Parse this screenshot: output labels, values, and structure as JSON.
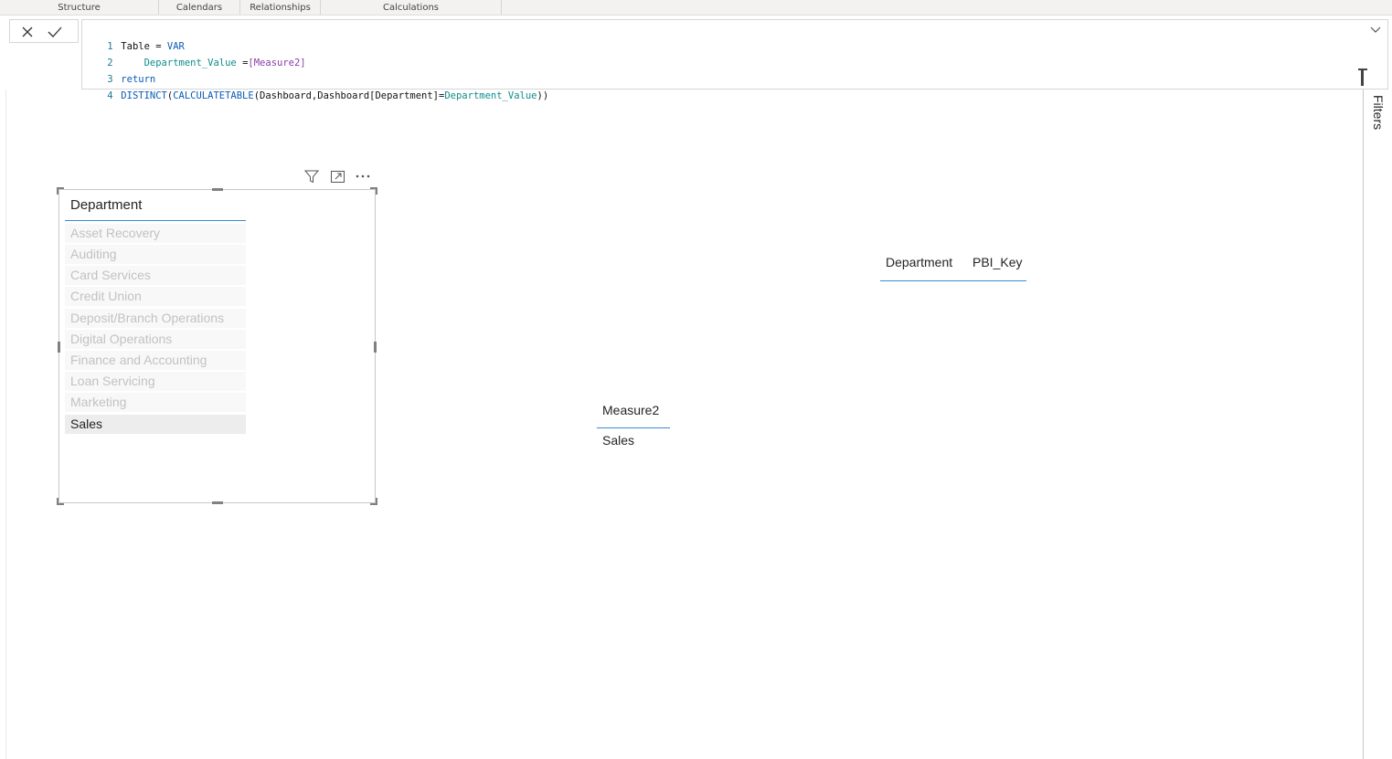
{
  "ribbon": {
    "groups": [
      "Structure",
      "Calendars",
      "Relationships",
      "Calculations"
    ]
  },
  "formula": {
    "lines": [
      {
        "num": "1",
        "parts": [
          {
            "t": "Table = ",
            "c": "plain"
          },
          {
            "t": "VAR",
            "c": "kw"
          }
        ]
      },
      {
        "num": "2",
        "parts": [
          {
            "t": "    ",
            "c": "plain"
          },
          {
            "t": "Department_Value",
            "c": "var"
          },
          {
            "t": " =",
            "c": "plain"
          },
          {
            "t": "[Measure2]",
            "c": "meas"
          }
        ]
      },
      {
        "num": "3",
        "parts": [
          {
            "t": "return",
            "c": "kw"
          }
        ]
      },
      {
        "num": "4",
        "parts": [
          {
            "t": "DISTINCT",
            "c": "fn"
          },
          {
            "t": "(",
            "c": "plain"
          },
          {
            "t": "CALCULATETABLE",
            "c": "fn"
          },
          {
            "t": "(Dashboard,Dashboard[Department]=",
            "c": "plain"
          },
          {
            "t": "Department_Value",
            "c": "var"
          },
          {
            "t": "))",
            "c": "plain"
          }
        ]
      }
    ]
  },
  "filters_pane": {
    "label": "Filters"
  },
  "slicer": {
    "title": "Department",
    "items": [
      {
        "label": "Asset Recovery",
        "selected": false
      },
      {
        "label": "Auditing",
        "selected": false
      },
      {
        "label": "Card Services",
        "selected": false
      },
      {
        "label": "Credit Union",
        "selected": false
      },
      {
        "label": "Deposit/Branch Operations",
        "selected": false
      },
      {
        "label": "Digital Operations",
        "selected": false
      },
      {
        "label": "Finance and Accounting",
        "selected": false
      },
      {
        "label": "Loan Servicing",
        "selected": false
      },
      {
        "label": "Marketing",
        "selected": false
      },
      {
        "label": "Sales",
        "selected": true
      }
    ]
  },
  "table_visual": {
    "columns": [
      "Department",
      "PBI_Key"
    ]
  },
  "measure_visual": {
    "header": "Measure2",
    "value": "Sales"
  },
  "colors": {
    "accent_underline": "#3a8ad6",
    "keyword": "#0a5cb5",
    "variable": "#0f8c8c",
    "measure": "#8a3ea8"
  }
}
